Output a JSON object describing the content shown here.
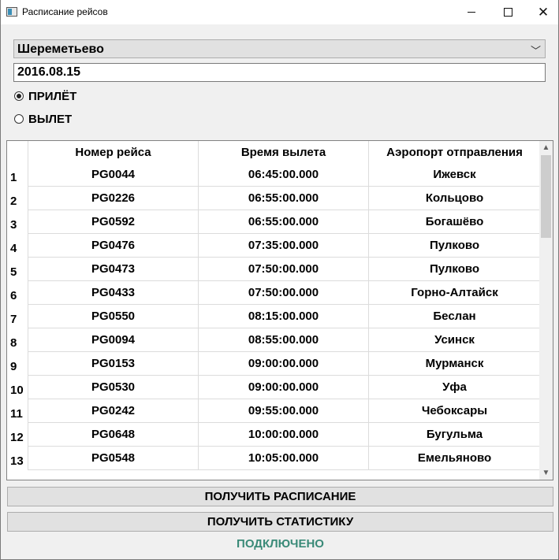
{
  "window": {
    "title": "Расписание рейсов",
    "icon": "app-window-icon"
  },
  "form": {
    "airport_selected": "Шереметьево",
    "date_value": "2016.08.15",
    "radio_arrival": "ПРИЛЁТ",
    "radio_departure": "ВЫЛЕТ",
    "arrival_checked": true
  },
  "table": {
    "headers": [
      "Номер рейса",
      "Время вылета",
      "Аэропорт отправления"
    ],
    "rows": [
      {
        "n": "1",
        "flight": "PG0044",
        "time": "06:45:00.000",
        "airport": "Ижевск"
      },
      {
        "n": "2",
        "flight": "PG0226",
        "time": "06:55:00.000",
        "airport": "Кольцово"
      },
      {
        "n": "3",
        "flight": "PG0592",
        "time": "06:55:00.000",
        "airport": "Богашёво"
      },
      {
        "n": "4",
        "flight": "PG0476",
        "time": "07:35:00.000",
        "airport": "Пулково"
      },
      {
        "n": "5",
        "flight": "PG0473",
        "time": "07:50:00.000",
        "airport": "Пулково"
      },
      {
        "n": "6",
        "flight": "PG0433",
        "time": "07:50:00.000",
        "airport": "Горно-Алтайск"
      },
      {
        "n": "7",
        "flight": "PG0550",
        "time": "08:15:00.000",
        "airport": "Беслан"
      },
      {
        "n": "8",
        "flight": "PG0094",
        "time": "08:55:00.000",
        "airport": "Усинск"
      },
      {
        "n": "9",
        "flight": "PG0153",
        "time": "09:00:00.000",
        "airport": "Мурманск"
      },
      {
        "n": "10",
        "flight": "PG0530",
        "time": "09:00:00.000",
        "airport": "Уфа"
      },
      {
        "n": "11",
        "flight": "PG0242",
        "time": "09:55:00.000",
        "airport": "Чебоксары"
      },
      {
        "n": "12",
        "flight": "PG0648",
        "time": "10:00:00.000",
        "airport": "Бугульма"
      },
      {
        "n": "13",
        "flight": "PG0548",
        "time": "10:05:00.000",
        "airport": "Емельяново"
      }
    ]
  },
  "buttons": {
    "get_schedule": "ПОЛУЧИТЬ РАСПИСАНИЕ",
    "get_stats": "ПОЛУЧИТЬ СТАТИСТИКУ"
  },
  "status": {
    "text": "ПОДКЛЮЧЕНО",
    "color": "#3a8a78"
  }
}
